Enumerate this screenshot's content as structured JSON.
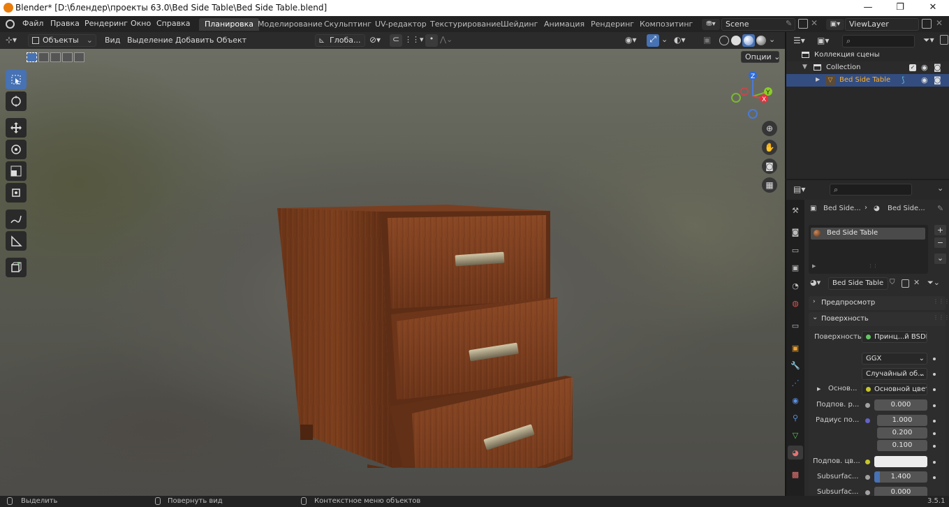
{
  "titlebar": {
    "title": "Blender* [D:\\блендер\\проекты 63.0\\Bed Side Table\\Bed Side Table.blend]",
    "minimize": "—",
    "maximize": "❐",
    "close": "✕"
  },
  "menu": {
    "items": [
      "Файл",
      "Правка",
      "Рендеринг",
      "Окно",
      "Справка"
    ]
  },
  "workspaces": {
    "tabs": [
      "Планировка",
      "Моделирование",
      "Скульптинг",
      "UV-редактор",
      "Текстурирование",
      "Шейдинг",
      "Анимация",
      "Рендеринг",
      "Композитинг"
    ],
    "active": "Планировка"
  },
  "scene": {
    "name": "Scene"
  },
  "viewlayer": {
    "name": "ViewLayer"
  },
  "viewport_header": {
    "mode": "Объекты",
    "menus": [
      "Вид",
      "Выделение",
      "Добавить",
      "Объект"
    ],
    "orientation": "Глоба...",
    "options": "Опции"
  },
  "gizmo": {
    "z": "Z",
    "y": "Y",
    "x": "X"
  },
  "outliner": {
    "search_placeholder": "",
    "scene_collection": "Коллекция сцены",
    "collection": "Collection",
    "object": "Bed Side Table"
  },
  "properties": {
    "search_placeholder": "",
    "breadcrumb_object": "Bed Side...",
    "breadcrumb_material": "Bed Side...",
    "material_slot": "Bed Side Table",
    "material_name": "Bed Side Table",
    "panel_preview": "Предпросмотр",
    "panel_surface": "Поверхность",
    "surface_label": "Поверхность",
    "surface_value": "Принц...й BSDF",
    "distribution": "GGX",
    "subsurface_method": "Случайный об...",
    "base_color_label": "Основ...",
    "base_color_value": "Основной цвет",
    "subsurface_label": "Подпов. р...",
    "subsurface_value": "0.000",
    "radius_label": "Радиус по...",
    "radius_values": [
      "1.000",
      "0.200",
      "0.100"
    ],
    "sss_color_label": "Подпов. цв...",
    "sss_ior_label": "Subsurfac...",
    "sss_ior_value": "1.400",
    "sss_aniso_label": "Subsurfac...",
    "sss_aniso_value": "0.000"
  },
  "statusbar": {
    "select": "Выделить",
    "rotate": "Повернуть вид",
    "context": "Контекстное меню объектов",
    "version": "3.5.1"
  },
  "colors": {
    "accent": "#4772b3",
    "selected_row": "#334d80",
    "object_text": "#ffaf29",
    "wood": "#7a3e1c"
  }
}
